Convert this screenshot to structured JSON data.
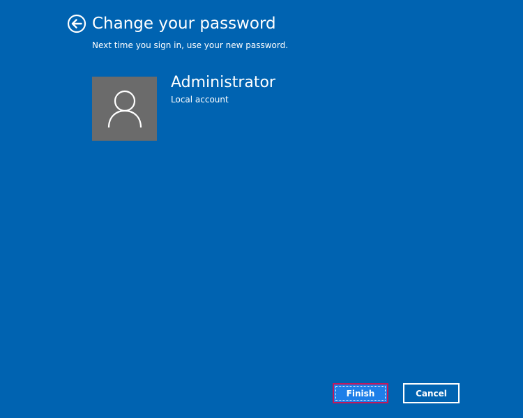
{
  "header": {
    "back_icon": "back-arrow-circle-icon",
    "title": "Change your password",
    "subtitle": "Next time you sign in, use your new password."
  },
  "account": {
    "avatar_icon": "user-silhouette-icon",
    "name": "Administrator",
    "type": "Local account"
  },
  "buttons": {
    "finish_label": "Finish",
    "cancel_label": "Cancel"
  },
  "colors": {
    "background": "#0063b1",
    "avatar_bg": "#6b6b6b",
    "finish_bg": "#1e7ee8",
    "focus_border": "#c2185b",
    "text": "#ffffff"
  }
}
